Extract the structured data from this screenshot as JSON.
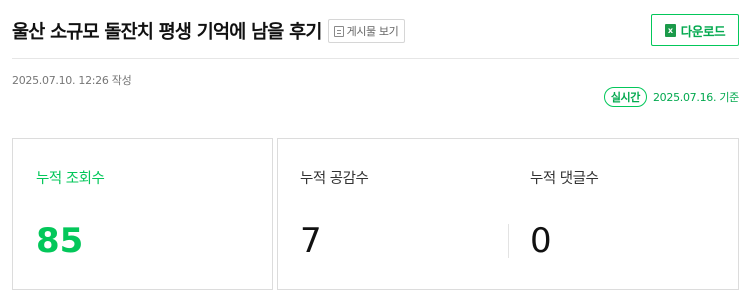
{
  "header": {
    "title": "울산 소규모 돌잔치 평생 기억에 남을 후기",
    "view_post_label": "게시물 보기",
    "download_label": "다운로드",
    "download_icon_glyph": "x",
    "written": "2025.07.10. 12:26 작성"
  },
  "realtime": {
    "badge": "실시간",
    "date": "2025.07.16. 기준"
  },
  "stats": {
    "views": {
      "label": "누적 조회수",
      "value": "85"
    },
    "likes": {
      "label": "누적 공감수",
      "value": "7"
    },
    "comments": {
      "label": "누적 댓글수",
      "value": "0"
    }
  },
  "colors": {
    "accent": "#03c75a",
    "text": "#111111",
    "muted": "#777777",
    "border": "#dcdcdc"
  },
  "icons": {
    "view_post": "document-icon",
    "download": "excel-icon"
  }
}
